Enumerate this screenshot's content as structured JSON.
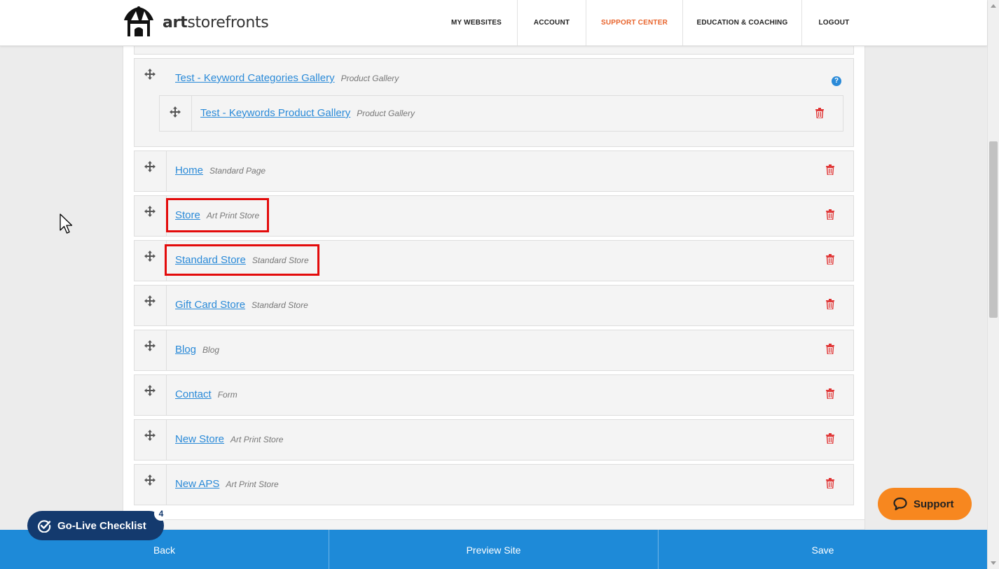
{
  "brand": {
    "logo_text_bold": "art",
    "logo_text_rest": "storefronts"
  },
  "nav": [
    {
      "label": "MY WEBSITES",
      "active": false
    },
    {
      "label": "ACCOUNT",
      "active": false
    },
    {
      "label": "SUPPORT CENTER",
      "active": true
    },
    {
      "label": "EDUCATION & COACHING",
      "active": false
    },
    {
      "label": "LOGOUT",
      "active": false
    }
  ],
  "pages": {
    "group": {
      "title": "Test - Keyword Categories Gallery",
      "type": "Product Gallery",
      "help": "?",
      "child": {
        "title": "Test - Keywords Product Gallery",
        "type": "Product Gallery"
      }
    },
    "items": [
      {
        "title": "Home",
        "type": "Standard Page"
      },
      {
        "title": "Store",
        "type": "Art Print Store"
      },
      {
        "title": "Standard Store",
        "type": "Standard Store"
      },
      {
        "title": "Gift Card Store",
        "type": "Standard Store"
      },
      {
        "title": "Blog",
        "type": "Blog"
      },
      {
        "title": "Contact",
        "type": "Form"
      },
      {
        "title": "New Store",
        "type": "Art Print Store"
      },
      {
        "title": "New APS",
        "type": "Art Print Store"
      }
    ]
  },
  "actions": {
    "back": "Back",
    "preview": "Preview Site",
    "save": "Save"
  },
  "golive": {
    "label": "Go-Live Checklist",
    "count": "4"
  },
  "support": {
    "label": "Support"
  },
  "colors": {
    "accent": "#1e8ad8",
    "link": "#2a8ad8",
    "active_nav": "#e8632b",
    "delete": "#e03030",
    "highlight": "#e30b0b",
    "golive": "#143a6e",
    "support": "#f7871f"
  }
}
